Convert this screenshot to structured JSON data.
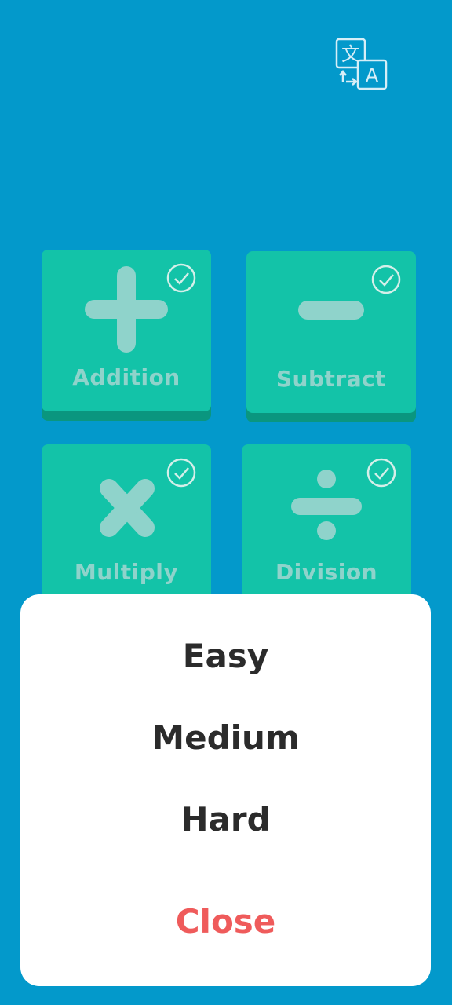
{
  "header": {
    "translate_icon": "translate-icon"
  },
  "operations": [
    {
      "label": "Addition",
      "icon": "plus-icon",
      "selected": true
    },
    {
      "label": "Subtract",
      "icon": "minus-icon",
      "selected": true
    },
    {
      "label": "Multiply",
      "icon": "multiply-icon",
      "selected": true
    },
    {
      "label": "Division",
      "icon": "divide-icon",
      "selected": true
    }
  ],
  "difficulty_sheet": {
    "options": [
      "Easy",
      "Medium",
      "Hard"
    ],
    "close_label": "Close"
  },
  "colors": {
    "background": "#0399cb",
    "tile": "#13c3a8",
    "tile_shadow": "#0a967f",
    "tile_symbol": "#8fd3cb",
    "sheet": "#ffffff",
    "option_text": "#2b2b2b",
    "close_text": "#ef5b5b"
  }
}
